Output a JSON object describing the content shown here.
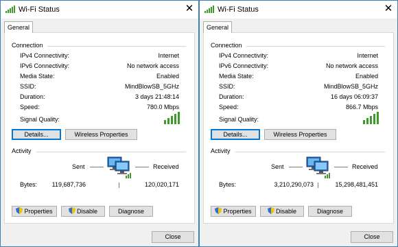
{
  "dialogs": [
    {
      "title": "Wi-Fi Status",
      "tab": "General",
      "connection_heading": "Connection",
      "rows": [
        {
          "label": "IPv4 Connectivity:",
          "value": "Internet"
        },
        {
          "label": "IPv6 Connectivity:",
          "value": "No network access"
        },
        {
          "label": "Media State:",
          "value": "Enabled"
        },
        {
          "label": "SSID:",
          "value": "MindBlowSB_5GHz"
        },
        {
          "label": "Duration:",
          "value": "3 days 21:48:14"
        },
        {
          "label": "Speed:",
          "value": "780.0 Mbps"
        }
      ],
      "signal_label": "Signal Quality:",
      "signal_bars": 5,
      "details_button": "Details...",
      "wireless_button": "Wireless Properties",
      "activity_heading": "Activity",
      "sent_label": "Sent",
      "received_label": "Received",
      "bytes_label": "Bytes:",
      "bytes_sent": "119,687,736",
      "bytes_received": "120,020,171",
      "properties_button": "Properties",
      "disable_button": "Disable",
      "diagnose_button": "Diagnose",
      "close_button": "Close"
    },
    {
      "title": "Wi-Fi Status",
      "tab": "General",
      "connection_heading": "Connection",
      "rows": [
        {
          "label": "IPv4 Connectivity:",
          "value": "Internet"
        },
        {
          "label": "IPv6 Connectivity:",
          "value": "No network access"
        },
        {
          "label": "Media State:",
          "value": "Enabled"
        },
        {
          "label": "SSID:",
          "value": "MindBlowSB_5GHz"
        },
        {
          "label": "Duration:",
          "value": "16 days 06:09:37"
        },
        {
          "label": "Speed:",
          "value": "866.7 Mbps"
        }
      ],
      "signal_label": "Signal Quality:",
      "signal_bars": 5,
      "details_button": "Details...",
      "wireless_button": "Wireless Properties",
      "activity_heading": "Activity",
      "sent_label": "Sent",
      "received_label": "Received",
      "bytes_label": "Bytes:",
      "bytes_sent": "3,210,290,073",
      "bytes_received": "15,298,481,451",
      "properties_button": "Properties",
      "disable_button": "Disable",
      "diagnose_button": "Diagnose",
      "close_button": "Close"
    }
  ],
  "icons": {
    "title": "wifi-signal-icon",
    "close": "close-icon",
    "signal": "signal-strength-icon",
    "activity": "network-computer-icon",
    "shield": "uac-shield-icon"
  },
  "colors": {
    "window_border": "#3c7fb1",
    "default_button_border": "#0078d7",
    "signal_green": "#3e9a2b",
    "dialog_background": "#f0f0f0"
  }
}
